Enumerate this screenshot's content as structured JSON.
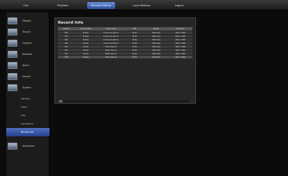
{
  "nav": {
    "tabs": [
      "Live",
      "Playback",
      "Remote Setting",
      "Local Settings",
      "Logout"
    ],
    "active": "Remote Setting"
  },
  "sidebar": {
    "items": [
      {
        "label": "Display",
        "icon": "monitor-icon"
      },
      {
        "label": "Record",
        "icon": "record-icon"
      },
      {
        "label": "Capture",
        "icon": "camera-icon"
      },
      {
        "label": "Network",
        "icon": "network-icon"
      },
      {
        "label": "Alarm",
        "icon": "alarm-icon"
      },
      {
        "label": "Device",
        "icon": "device-icon"
      },
      {
        "label": "System",
        "icon": "system-icon"
      }
    ],
    "sub_items": [
      "General",
      "Users",
      "Info",
      "Log Search",
      "Record Info"
    ],
    "active_sub": "Record Info",
    "extra_item": {
      "label": "Advanced",
      "icon": "advanced-icon"
    }
  },
  "record_info": {
    "title": "Record Info",
    "columns": [
      "Channel",
      "Record State",
      "Stream Type",
      "FPS",
      "Bitrate",
      "Resolution"
    ],
    "rows": [
      [
        "CH1",
        "Enable",
        "Continuous Record",
        "25 fps",
        "2048 kbps",
        "1920 x 1080"
      ],
      [
        "CH2",
        "Enable",
        "Continuous Record",
        "25 fps",
        "2048 kbps",
        "1920 x 1080"
      ],
      [
        "CH3",
        "Enable",
        "Continuous Record",
        "25 fps",
        "2048 kbps",
        "1920 x 1080"
      ],
      [
        "CH4",
        "Enable",
        "Continuous Record",
        "25 fps",
        "2048 kbps",
        "1920 x 1080"
      ],
      [
        "CH5",
        "Enable",
        "Motion Record",
        "25 fps",
        "2048 kbps",
        "1920 x 1080"
      ],
      [
        "CH6",
        "Enable",
        "Motion Record",
        "25 fps",
        "2048 kbps",
        "1920 x 1080"
      ],
      [
        "CH7",
        "Enable",
        "Motion Record",
        "25 fps",
        "2048 kbps",
        "1920 x 1080"
      ],
      [
        "CH8",
        "Enable",
        "Motion Record",
        "25 fps",
        "2048 kbps",
        "1920 x 1080"
      ]
    ]
  },
  "colors": {
    "accent": "#3b5fb5",
    "background": "#0b0b0b",
    "panel": "#262626"
  }
}
